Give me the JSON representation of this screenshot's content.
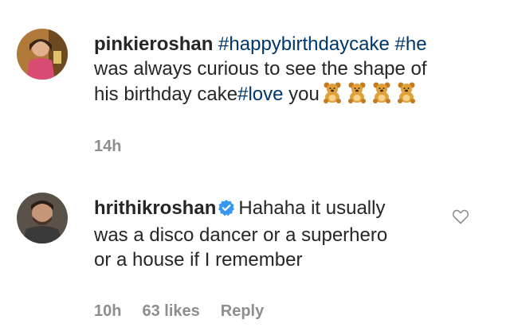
{
  "comments": [
    {
      "username": "pinkieroshan",
      "hashtag1": "#happybirthdaycake",
      "hashtag2": "#he",
      "line2": "was always curious to see the shape of",
      "line3_start": "his birthday cake",
      "hashtag3": "#love",
      "line3_end": " you",
      "emoji_icon": "teddy-bear-icon",
      "emoji_count": 4,
      "time": "14h"
    },
    {
      "username": "hrithikroshan",
      "verified": true,
      "line1": "Hahaha it usually",
      "line2": "was a disco dancer or a superhero",
      "line3": "or a house if I remember",
      "time": "10h",
      "likes": "63 likes",
      "reply_label": "Reply"
    }
  ],
  "colors": {
    "hashtag": "#00376b",
    "meta": "#8e8e8e",
    "verified": "#3897f0",
    "text": "#262626"
  }
}
